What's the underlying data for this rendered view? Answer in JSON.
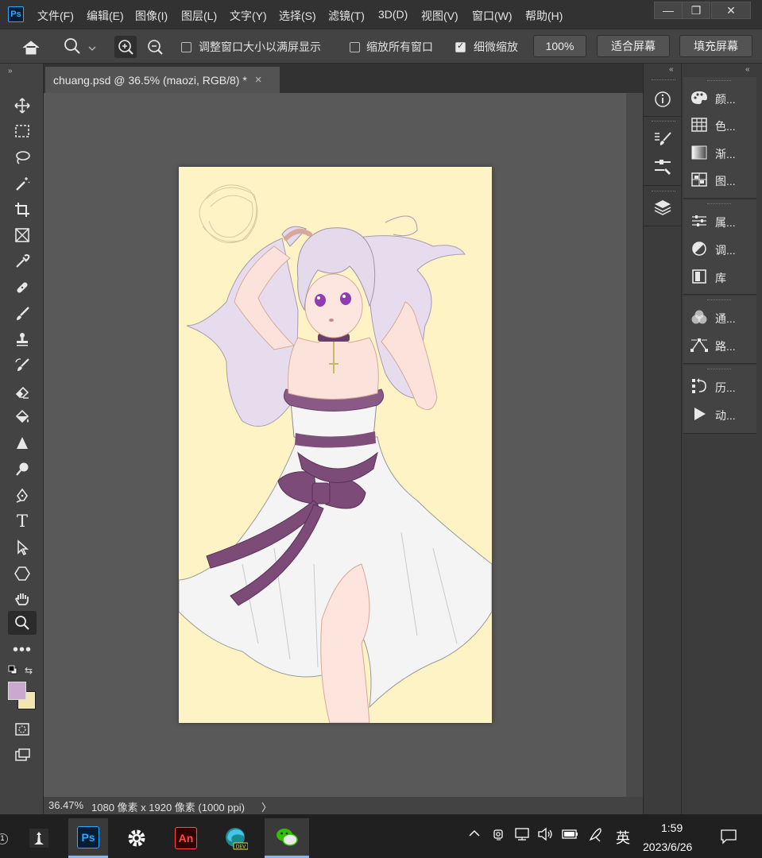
{
  "app": {
    "logo": "Ps"
  },
  "menu": [
    "文件(F)",
    "编辑(E)",
    "图像(I)",
    "图层(L)",
    "文字(Y)",
    "选择(S)",
    "滤镜(T)",
    "3D(D)",
    "视图(V)",
    "窗口(W)",
    "帮助(H)"
  ],
  "window_controls": {
    "minimize": "—",
    "restore": "❐",
    "close": "✕"
  },
  "options": {
    "resize_windows": {
      "label": "调整窗口大小以满屏显示",
      "checked": false
    },
    "zoom_all": {
      "label": "缩放所有窗口",
      "checked": false
    },
    "scrubby_zoom": {
      "label": "细微缩放",
      "checked": true
    },
    "zoom_value": "100%",
    "fit_screen": "适合屏幕",
    "fill_screen": "填充屏幕"
  },
  "document": {
    "tab_title": "chuang.psd @ 36.5% (maozi, RGB/8) *",
    "close": "×"
  },
  "status": {
    "zoom": "36.47%",
    "info": "1080 像素 x 1920 像素 (1000 ppi)",
    "arrow": "〉"
  },
  "colors": {
    "foreground": "#c9a9cd",
    "background": "#efe6b0",
    "canvas_bg": "#fdf3c4"
  },
  "tools": [
    "move-tool",
    "marquee-tool",
    "lasso-tool",
    "magic-wand-tool",
    "crop-tool",
    "frame-tool",
    "eyedropper-tool",
    "healing-brush-tool",
    "brush-tool",
    "clone-stamp-tool",
    "history-brush-tool",
    "eraser-tool",
    "paint-bucket-tool",
    "sharpen-tool",
    "dodge-tool",
    "pen-tool",
    "type-tool",
    "path-selection-tool",
    "shape-tool",
    "hand-tool",
    "zoom-tool",
    "more-tools"
  ],
  "panels": [
    {
      "icon": "palette-icon",
      "label": "颜..."
    },
    {
      "icon": "swatches-icon",
      "label": "色..."
    },
    {
      "icon": "gradient-icon",
      "label": "渐..."
    },
    {
      "icon": "patterns-icon",
      "label": "图..."
    },
    {
      "icon": "properties-icon",
      "label": "属..."
    },
    {
      "icon": "adjustments-icon",
      "label": "调..."
    },
    {
      "icon": "libraries-icon",
      "label": "库"
    },
    {
      "icon": "channels-icon",
      "label": "通..."
    },
    {
      "icon": "paths-icon",
      "label": "路..."
    },
    {
      "icon": "history-icon",
      "label": "历..."
    },
    {
      "icon": "actions-icon",
      "label": "动..."
    }
  ],
  "taskbar": {
    "apps": [
      "chess-app",
      "Ps",
      "settings",
      "An",
      "edge-dev",
      "wechat"
    ],
    "ime": "英",
    "time": "1:59",
    "date": "2023/6/26",
    "dev_badge": "DEV"
  }
}
